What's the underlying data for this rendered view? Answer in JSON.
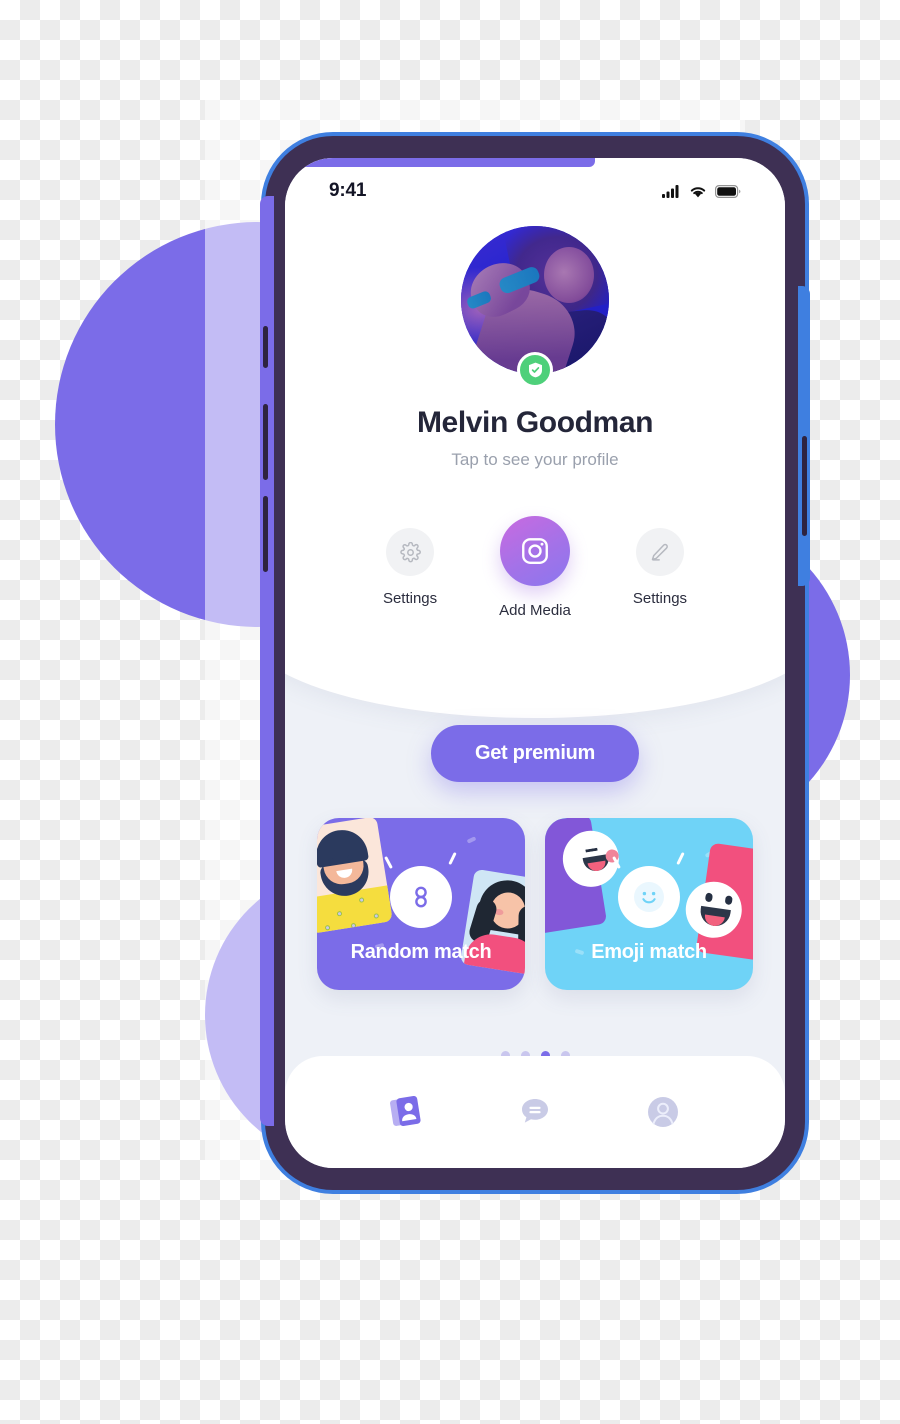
{
  "app": {
    "screen_title": "Profile home",
    "background": {
      "checkerboard": true,
      "blob_color": "#7b6ce8"
    }
  },
  "device": {
    "frame_color": "#3e3054",
    "edge_highlight_color": "#3f7fe0",
    "rail_color": "#7b6ce8"
  },
  "status_bar": {
    "time": "9:41",
    "icons": [
      "cellular-signal-icon",
      "wifi-icon",
      "battery-icon"
    ]
  },
  "profile": {
    "name": "Melvin Goodman",
    "subtitle": "Tap to see your profile",
    "avatar_alt": "concert-photo-avatar",
    "verified_badge": {
      "icon": "shield-check-icon",
      "color": "#4ed07a"
    }
  },
  "actions": [
    {
      "label": "Settings",
      "icon": "gear-icon"
    },
    {
      "label": "Add Media",
      "icon": "camera-icon",
      "accent": "#a372e8"
    },
    {
      "label": "Settings",
      "icon": "pencil-icon"
    }
  ],
  "premium": {
    "label": "Get premium",
    "color": "#7b6ce8"
  },
  "match_cards": [
    {
      "title": "Random match",
      "background": "#7b6ce8",
      "hub_icon": "infinity-link-icon"
    },
    {
      "title": "Emoji match",
      "background": "#6fd3f7",
      "hub_icon": "smiley-face-icon"
    }
  ],
  "pagination": {
    "total": 4,
    "active_index": 2
  },
  "bottom_nav": [
    {
      "name": "cards",
      "icon": "contact-cards-icon",
      "active": true
    },
    {
      "name": "chat",
      "icon": "chat-bubble-icon",
      "active": false
    },
    {
      "name": "profile",
      "icon": "user-avatar-icon",
      "active": false
    }
  ]
}
